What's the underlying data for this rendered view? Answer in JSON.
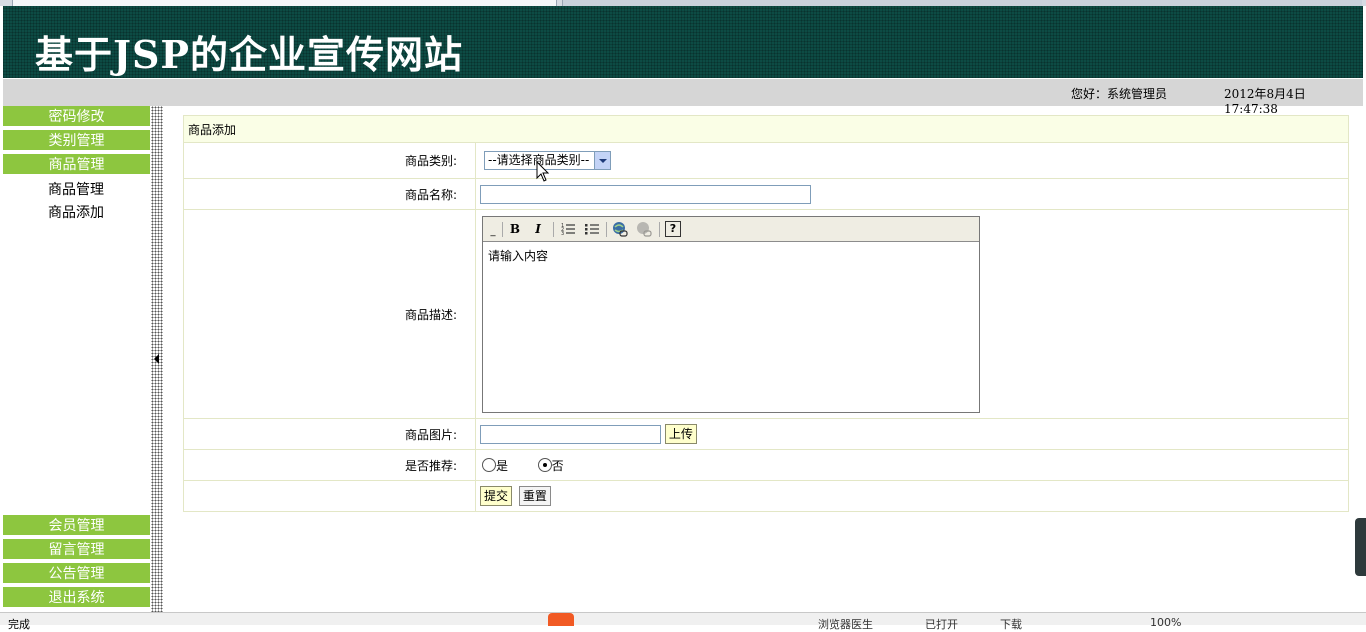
{
  "header": {
    "site_title": "基于JSP的企业宣传网站",
    "greeting": "您好：系统管理员",
    "datetime": "2012年8月4日  17:47:38"
  },
  "sidebar": {
    "menus_top": [
      {
        "label": "密码修改"
      },
      {
        "label": "类别管理"
      },
      {
        "label": "商品管理"
      }
    ],
    "sub_items": [
      {
        "label": "商品管理"
      },
      {
        "label": "商品添加"
      }
    ],
    "menus_bottom": [
      {
        "label": "会员管理"
      },
      {
        "label": "留言管理"
      },
      {
        "label": "公告管理"
      },
      {
        "label": "退出系统"
      }
    ]
  },
  "form": {
    "caption": "商品添加",
    "category_label": "商品类别:",
    "category_selected": "--请选择商品类别--",
    "name_label": "商品名称:",
    "name_value": "",
    "desc_label": "商品描述:",
    "desc_content": "请输入内容",
    "image_label": "商品图片:",
    "image_value": "",
    "upload_button": "上传",
    "recommend_label": "是否推荐:",
    "recommend_yes": "是",
    "recommend_no": "否",
    "recommend_selected": "否",
    "submit_button": "提交",
    "reset_button": "重置"
  },
  "editor_toolbar": {
    "bold": "B",
    "italic": "I",
    "help": "?"
  },
  "status_bar": {
    "state": "完成",
    "doctor": "浏览器医生",
    "open": "已打开",
    "download": "下载",
    "zoom": "100%"
  }
}
